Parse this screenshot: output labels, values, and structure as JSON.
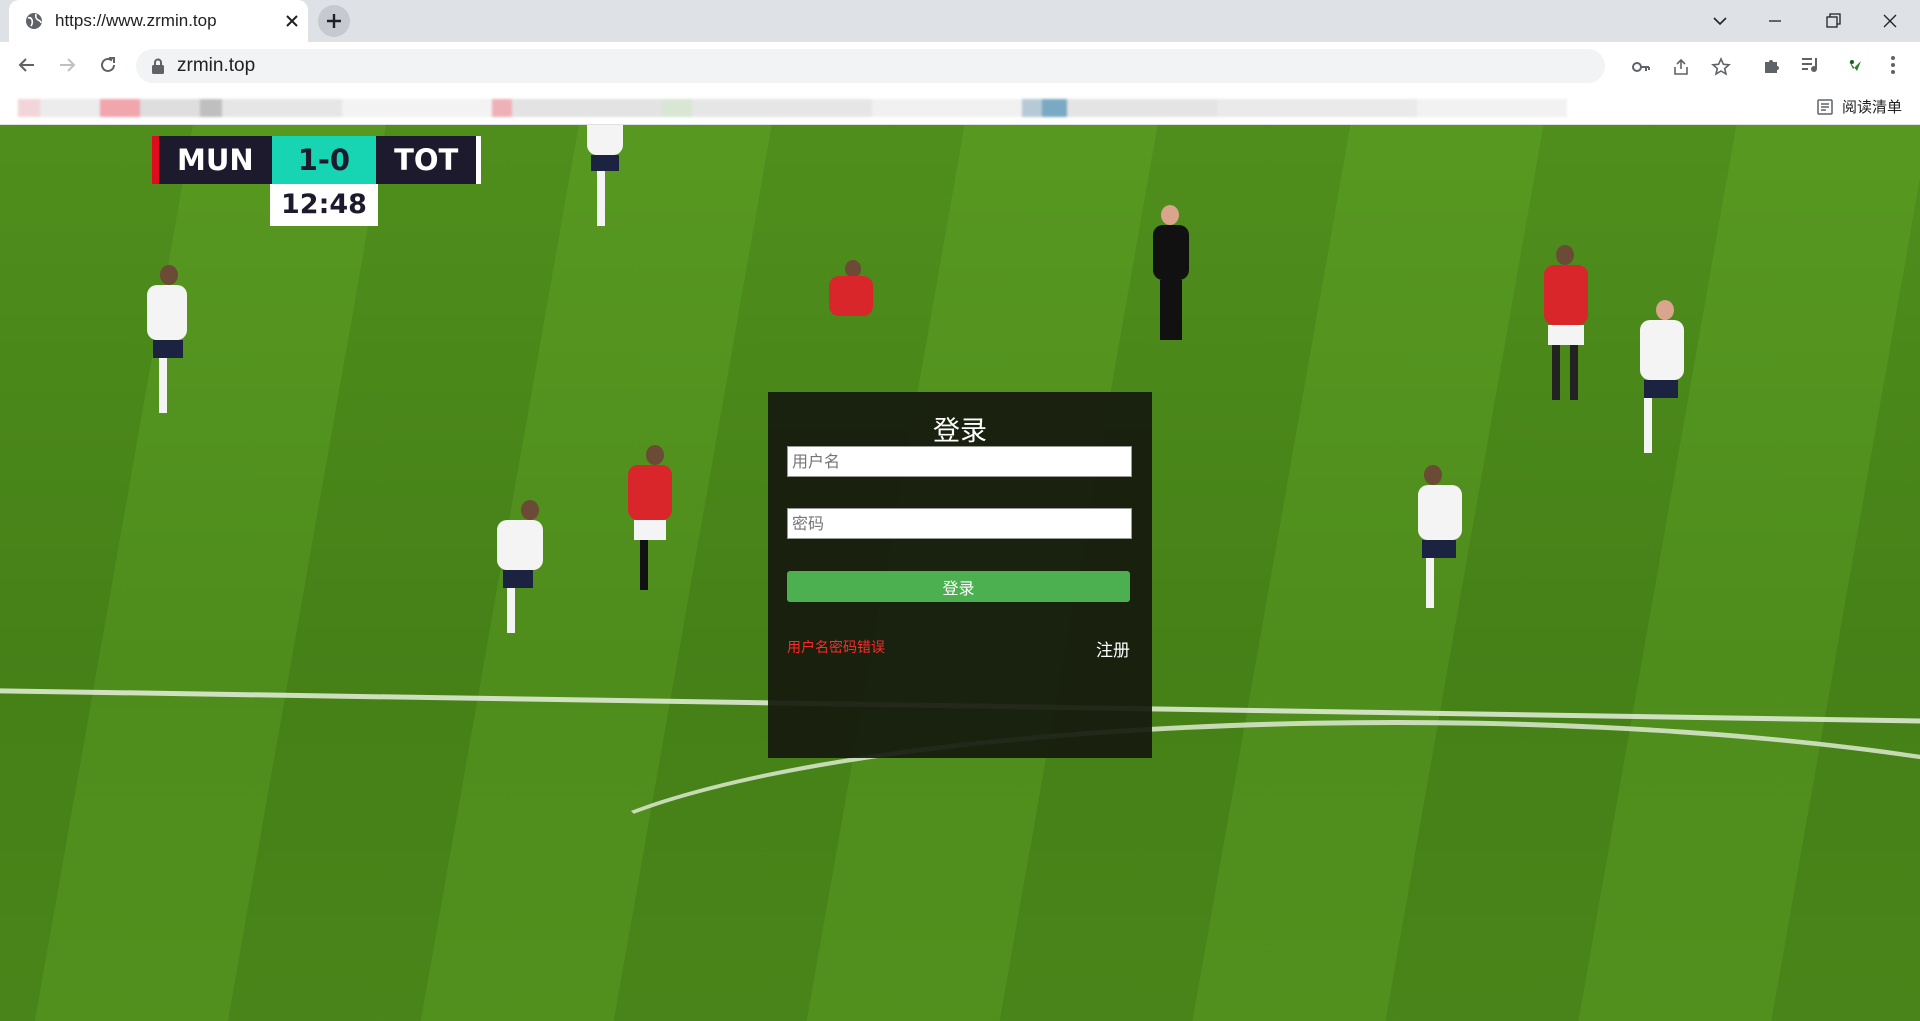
{
  "browser": {
    "tab_title": "https://www.zrmin.top",
    "url": "zrmin.top",
    "reading_list_label": "阅读清单"
  },
  "scoreboard": {
    "home": "MUN",
    "score": "1-0",
    "away": "TOT",
    "clock": "12:48"
  },
  "login": {
    "title": "登录",
    "username_placeholder": "用户名",
    "password_placeholder": "密码",
    "submit_label": "登录",
    "error_message": "用户名密码错误",
    "register_label": "注册",
    "button_color": "#4caf50",
    "error_color": "#ff2a2a"
  },
  "icons": {
    "tab_favicon": "globe-icon",
    "tab_close": "close-icon",
    "new_tab": "plus-icon",
    "back": "arrow-left-icon",
    "forward": "arrow-right-icon",
    "reload": "reload-icon",
    "lock": "lock-icon",
    "key": "key-icon",
    "share": "share-icon",
    "bookmark_star": "star-icon",
    "extensions": "puzzle-icon",
    "media": "media-control-icon",
    "profile": "profile-avatar-icon",
    "menu": "kebab-menu-icon",
    "reading_list": "reading-list-icon"
  }
}
